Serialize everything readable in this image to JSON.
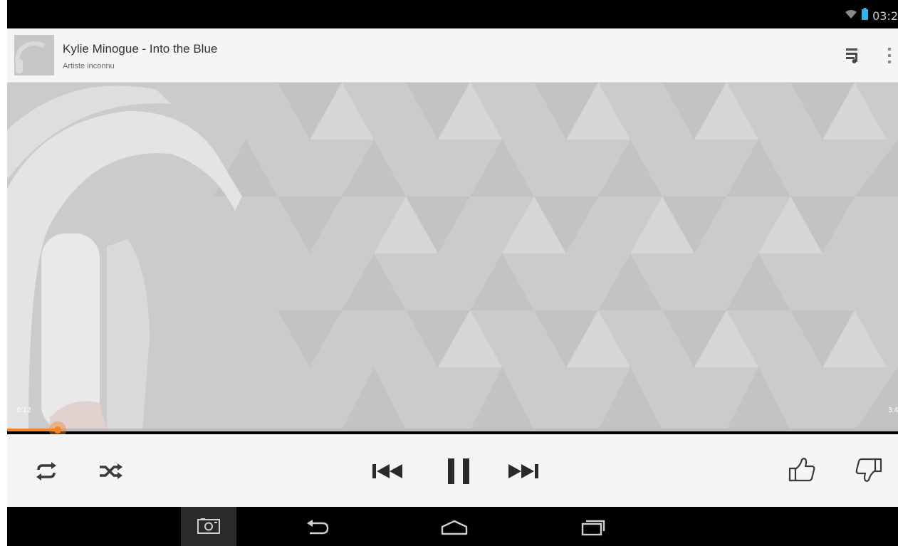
{
  "status_bar": {
    "time": "03:2",
    "wifi_icon": "wifi-icon",
    "battery_icon": "battery-icon"
  },
  "header": {
    "title": "Kylie Minogue - Into the Blue",
    "artist": "Artiste inconnu",
    "queue_icon": "queue-icon",
    "overflow_icon": "overflow-menu-icon"
  },
  "player": {
    "elapsed": "0:12",
    "total": "3:4",
    "progress_fraction": 0.057,
    "accent_color": "#f4842c"
  },
  "controls": {
    "repeat_icon": "repeat-icon",
    "shuffle_icon": "shuffle-icon",
    "previous_icon": "previous-icon",
    "pause_icon": "pause-icon",
    "next_icon": "next-icon",
    "thumbs_up_icon": "thumbs-up-icon",
    "thumbs_down_icon": "thumbs-down-icon"
  },
  "nav_bar": {
    "screenshot_icon": "screenshot-icon",
    "back_icon": "back-icon",
    "home_icon": "home-icon",
    "recents_icon": "recents-icon"
  }
}
